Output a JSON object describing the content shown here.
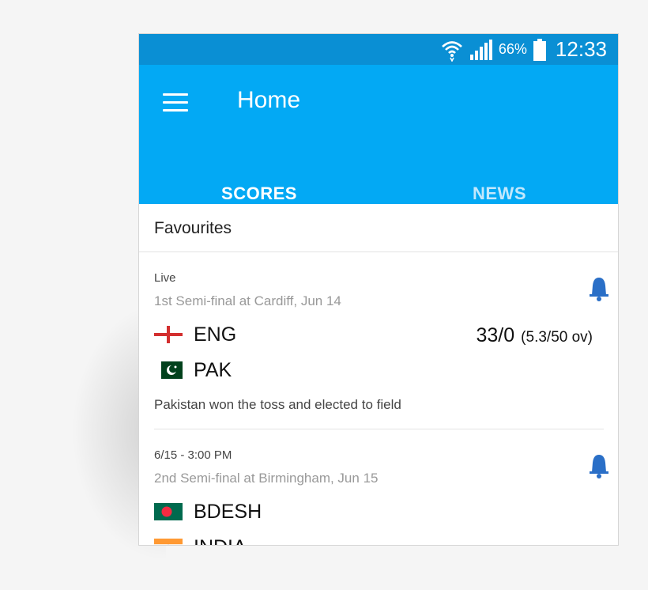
{
  "status_bar": {
    "battery_percent": "66%",
    "time": "12:33"
  },
  "app_bar": {
    "title": "Home"
  },
  "tabs": [
    {
      "label": "SCORES",
      "active": true
    },
    {
      "label": "NEWS",
      "active": false
    }
  ],
  "favourites": {
    "header": "Favourites",
    "matches": [
      {
        "status": "Live",
        "venue": "1st Semi-final at Cardiff, Jun 14",
        "teams": [
          {
            "name": "ENG",
            "flag": "england-flag",
            "score": "33/0",
            "overs": "(5.3/50 ov)"
          },
          {
            "name": "PAK",
            "flag": "pakistan-flag"
          }
        ],
        "result": "Pakistan won the toss and elected to field"
      },
      {
        "status": "6/15 - 3:00 PM",
        "venue": "2nd Semi-final at Birmingham, Jun 15",
        "teams": [
          {
            "name": "BDESH",
            "flag": "bangladesh-flag"
          },
          {
            "name": "INDIA",
            "flag": "india-flag"
          }
        ]
      }
    ]
  },
  "colors": {
    "status_bar": "#0a8fd4",
    "app_bar": "#03a9f4",
    "bell": "#2a6fc7"
  }
}
